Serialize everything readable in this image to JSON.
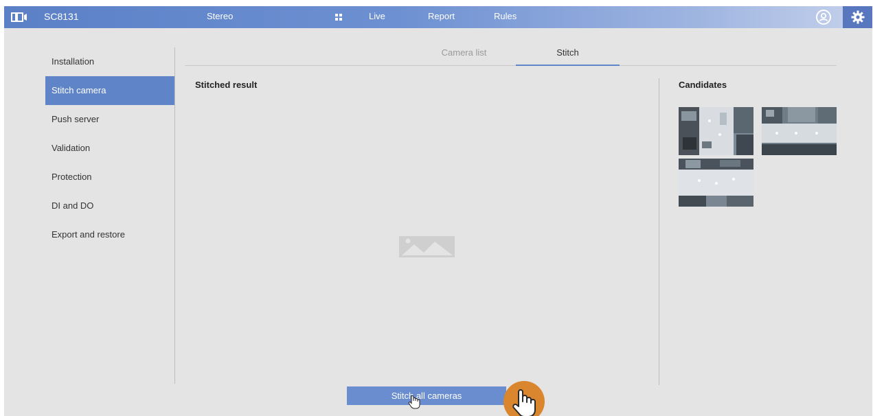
{
  "header": {
    "model": "SC8131",
    "nav": {
      "stereo": "Stereo",
      "live": "Live",
      "report": "Report",
      "rules": "Rules"
    },
    "icons": {
      "logo": "camera-logo-icon",
      "grid": "grid-icon",
      "user": "user-icon",
      "settings": "gear-icon"
    }
  },
  "sidebar": {
    "items": [
      {
        "label": "Installation"
      },
      {
        "label": "Stitch camera"
      },
      {
        "label": "Push server"
      },
      {
        "label": "Validation"
      },
      {
        "label": "Protection"
      },
      {
        "label": "DI and DO"
      },
      {
        "label": "Export and restore"
      }
    ],
    "active_index": 1
  },
  "tabs": {
    "camera_list": "Camera list",
    "stitch": "Stitch",
    "active": "Stitch"
  },
  "main": {
    "stitched_title": "Stitched result",
    "candidates_title": "Candidates",
    "stitch_button": "Stitch all cameras"
  },
  "colors": {
    "accent": "#5f84c7",
    "button": "#6a8dd0",
    "background": "#e4e4e4",
    "tap_badge": "#d9862e"
  }
}
